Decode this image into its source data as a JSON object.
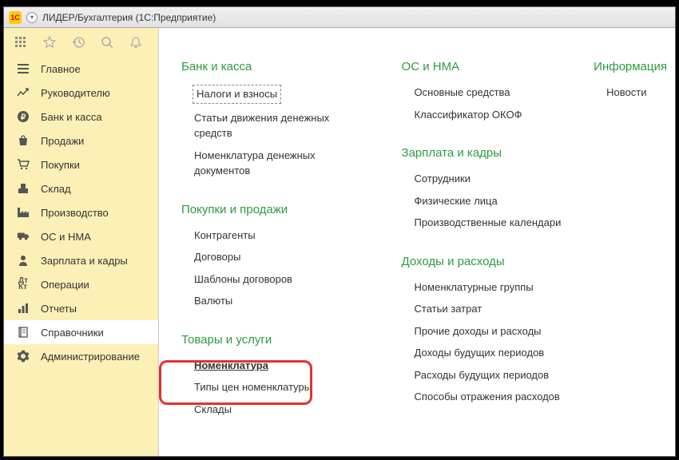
{
  "title": "ЛИДЕР/Бухгалтерия  (1С:Предприятие)",
  "sidebar": {
    "items": [
      {
        "label": "Главное"
      },
      {
        "label": "Руководителю"
      },
      {
        "label": "Банк и касса"
      },
      {
        "label": "Продажи"
      },
      {
        "label": "Покупки"
      },
      {
        "label": "Склад"
      },
      {
        "label": "Производство"
      },
      {
        "label": "ОС и НМА"
      },
      {
        "label": "Зарплата и кадры"
      },
      {
        "label": "Операции"
      },
      {
        "label": "Отчеты"
      },
      {
        "label": "Справочники"
      },
      {
        "label": "Администрирование"
      }
    ]
  },
  "columns": [
    {
      "sections": [
        {
          "title": "Банк и касса",
          "items": [
            "Налоги и взносы",
            "Статьи движения денежных средств",
            "Номенклатура денежных документов"
          ]
        },
        {
          "title": "Покупки и продажи",
          "items": [
            "Контрагенты",
            "Договоры",
            "Шаблоны договоров",
            "Валюты"
          ]
        },
        {
          "title": "Товары и услуги",
          "items": [
            "Номенклатура",
            "Типы цен номенклатуры",
            "Склады"
          ]
        }
      ]
    },
    {
      "sections": [
        {
          "title": "ОС и НМА",
          "items": [
            "Основные средства",
            "Классификатор ОКОФ"
          ]
        },
        {
          "title": "Зарплата и кадры",
          "items": [
            "Сотрудники",
            "Физические лица",
            "Производственные календари"
          ]
        },
        {
          "title": "Доходы и расходы",
          "items": [
            "Номенклатурные группы",
            "Статьи затрат",
            "Прочие доходы и расходы",
            "Доходы будущих периодов",
            "Расходы будущих периодов",
            "Способы отражения расходов"
          ]
        }
      ]
    },
    {
      "sections": [
        {
          "title": "Информация",
          "items": [
            "Новости"
          ]
        }
      ]
    }
  ]
}
